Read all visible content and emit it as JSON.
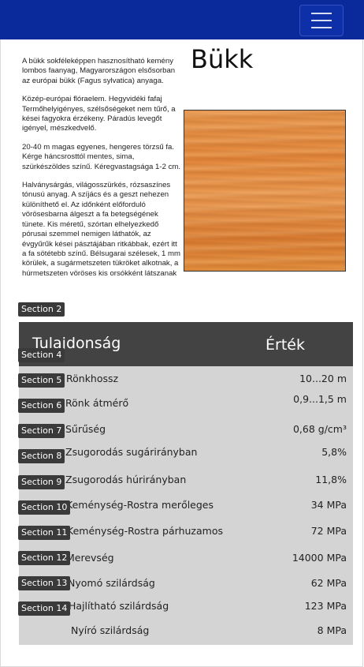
{
  "navbar": {
    "menu_icon": "hamburger-menu-icon",
    "color": "#0a2a9c"
  },
  "page": {
    "title": "Bükk"
  },
  "description": [
    "A bükk sokféleképpen hasznosítható kemény lombos faanyag, Magyarországon elsősorban az európai bükk (Fagus sylvatica) anyaga.",
    "Közép-európai flóraelem. Hegyvidéki fafaj Termőhelyigényes, szélsőségeket nem tűrő, a kései fagyokra érzékeny. Páradús levegőt igényel, mészkedvelő.",
    "20-40 m magas egyenes, hengeres törzsű fa. Kérge háncsrosttól mentes, sima, szürkészöldes színű. Kéregvastagsága 1-2 cm.",
    "Halványsárgás, világosszürkés, rózsaszínes tónusú anyag. A szíjács és a geszt nehezen különíthető el. Az időnként előforduló vörösesbarna álgeszt a fa betegségének tünete. Kis méretű, szórtan elhelyezkedő pórusai szemmel nemigen láthatók, az évgyűrűk kései pásztájában ritkábbak, ezért itt a fa sötétebb színű. Bélsugarai szélesek, 1 mm körülek, a sugármetszeten tükröket alkotnak, a húrmetszeten vöröses kis orsókként látszanak"
  ],
  "image": {
    "name": "beech-wood-texture"
  },
  "sections": [
    "Section 2",
    "Section 4",
    "Section 5",
    "Section 6",
    "Section 7",
    "Section 8",
    "Section 9",
    "Section 10",
    "Section 11",
    "Section 12",
    "Section 13",
    "Section 14"
  ],
  "table": {
    "headers": {
      "property": "Tulajdonság",
      "value": "Érték"
    },
    "rows": [
      {
        "property": "Rönkhossz",
        "value": "10...20 m"
      },
      {
        "property": "Rönk átmérő",
        "value": "0,9...1,5 m"
      },
      {
        "property": "Sűrűség",
        "value": "0,68 g/cm³"
      },
      {
        "property": "Zsugorodás sugárirányban",
        "value": "5,8%"
      },
      {
        "property": "Zsugorodás húrirányban",
        "value": "11,8%"
      },
      {
        "property": "Keménység-Rostra merőleges",
        "value": "34 MPa"
      },
      {
        "property": "Keménység-Rostra párhuzamos",
        "value": "72 MPa"
      },
      {
        "property": "Merevség",
        "value": "14000 MPa"
      },
      {
        "property": "Nyomó szilárdság",
        "value": "62 MPa"
      },
      {
        "property": "Hajlítható szilárdság",
        "value": "123 MPa"
      },
      {
        "property": "Nyíró szilárdság",
        "value": "8 MPa"
      }
    ]
  }
}
